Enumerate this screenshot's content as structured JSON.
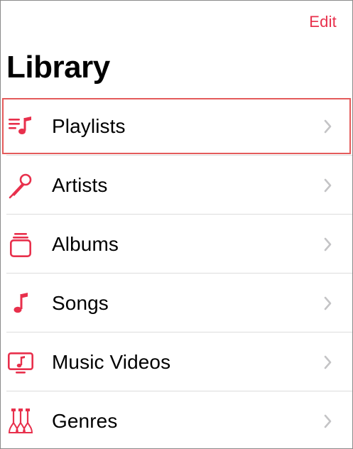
{
  "header": {
    "edit_label": "Edit",
    "title": "Library"
  },
  "colors": {
    "accent": "#e8304c",
    "chevron": "#c4c4c6",
    "separator": "#dcdcdc",
    "highlight_outline": "#e45b5b"
  },
  "library": {
    "items": [
      {
        "label": "Playlists",
        "icon": "playlists-icon",
        "highlighted": true
      },
      {
        "label": "Artists",
        "icon": "artists-microphone-icon",
        "highlighted": false
      },
      {
        "label": "Albums",
        "icon": "albums-icon",
        "highlighted": false
      },
      {
        "label": "Songs",
        "icon": "music-note-icon",
        "highlighted": false
      },
      {
        "label": "Music Videos",
        "icon": "music-videos-icon",
        "highlighted": false
      },
      {
        "label": "Genres",
        "icon": "genres-guitar-icon",
        "highlighted": false
      }
    ]
  }
}
